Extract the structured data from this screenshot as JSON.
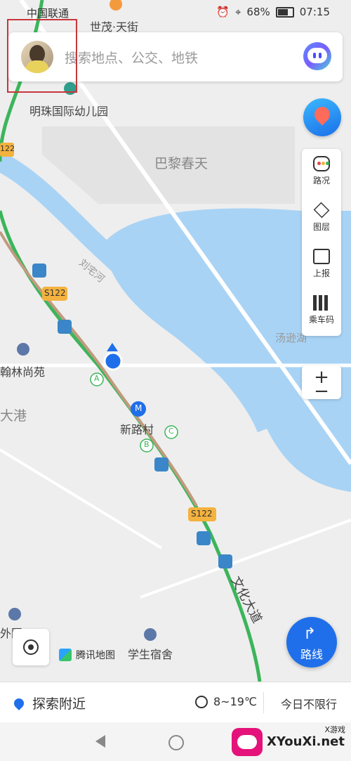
{
  "status_bar": {
    "carrier": "中国联通",
    "battery": "68%",
    "time": "07:15"
  },
  "search": {
    "placeholder": "搜索地点、公交、地铁"
  },
  "map_labels": {
    "shimao": "世茂·天街",
    "kindergarten": "明珠国际幼儿园",
    "bali": "巴黎春天",
    "hanlin": "翰林尚苑",
    "dagang": "大港",
    "xinlucun": "新路村",
    "s122_a": "S122",
    "s122_b": "S122",
    "road122": "122",
    "river": "刘宅河",
    "lake": "汤逊湖",
    "avenue": "文化大道",
    "dorm": "学生宿舍",
    "waiguo": "外国",
    "station_a": "A",
    "station_b": "B",
    "station_c": "C",
    "metro": "M"
  },
  "toolbar": [
    {
      "label": "路况",
      "icon": "traffic-icon"
    },
    {
      "label": "图层",
      "icon": "layers-icon"
    },
    {
      "label": "上报",
      "icon": "report-icon"
    },
    {
      "label": "乘车码",
      "icon": "qr-icon"
    }
  ],
  "zoom": {
    "plus": "+",
    "minus": "−"
  },
  "route_button": {
    "label": "路线"
  },
  "logo": {
    "text": "腾讯地图"
  },
  "bottom_bar": {
    "explore": "探索附近",
    "weather": "8~19℃",
    "restriction": "今日不限行"
  },
  "watermark": {
    "site": "XYouXi.net",
    "small": "X游戏"
  },
  "colors": {
    "accent": "#1f6fea",
    "lake": "#a8d3f5",
    "route_green": "#3cb55a"
  }
}
